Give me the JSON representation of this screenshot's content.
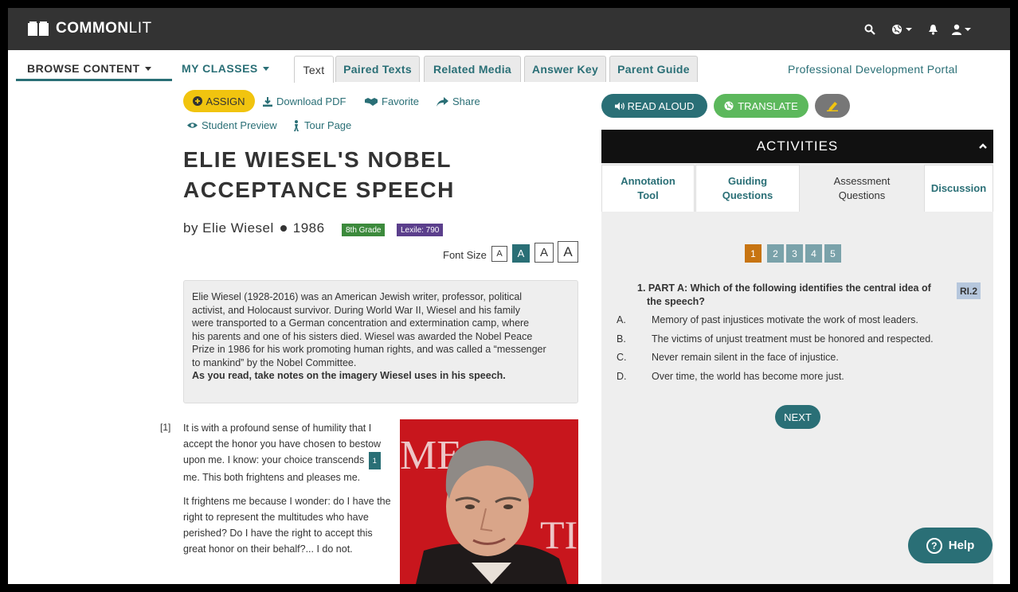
{
  "app": {
    "logo_bold": "COMMON",
    "logo_light": "LIT"
  },
  "nav": {
    "browse": "BROWSE CONTENT",
    "my_classes": "MY CLASSES",
    "tabs": [
      "Text",
      "Paired Texts",
      "Related Media",
      "Answer Key",
      "Parent Guide"
    ],
    "active_tab": "Text",
    "pd_portal": "Professional Development Portal"
  },
  "actions": {
    "assign": "ASSIGN",
    "download_pdf": "Download PDF",
    "favorite": "Favorite",
    "share": "Share",
    "student_preview": "Student Preview",
    "tour_page": "Tour Page"
  },
  "text": {
    "title_line1": "ELIE WIESEL'S NOBEL",
    "title_line2": "ACCEPTANCE SPEECH",
    "author": "by Elie Wiesel",
    "year": "1986",
    "grade": "8th Grade",
    "lexile": "Lexile: 790",
    "font_size_label": "Font Size",
    "font_size_buttons": [
      "A",
      "A",
      "A",
      "A"
    ],
    "font_size_active_index": 1,
    "intro_lines": [
      "Elie Wiesel (1928-2016) was an American Jewish writer, professor, political",
      "activist, and Holocaust survivor. During World War II, Wiesel and his family",
      "were transported to a German concentration and extermination camp, where",
      "his parents and one of his sisters died. Wiesel was awarded the Nobel Peace",
      "Prize in 1986 for his work promoting human rights, and was called a “messenger",
      "to mankind” by the Nobel Committee."
    ],
    "intro_bold": "As you read, take notes on the imagery Wiesel uses in his speech.",
    "para_num": "[1]",
    "p1_before": "It is with a profound sense of humility that I accept the honor you have chosen to bestow upon me. I know: your choice transcends",
    "p1_footnote": "1",
    "p1_after": "me. This both frightens and pleases me.",
    "p2": "It frightens me because I wonder: do I have the right to represent the multitudes who have perished? Do I have the right to accept this great honor on their behalf?... I do not."
  },
  "activities": {
    "read_aloud": "READ ALOUD",
    "translate": "TRANSLATE",
    "header": "ACTIVITIES",
    "tabs": [
      "Annotation Tool",
      "Guiding Questions",
      "Assessment Questions",
      "Discussion"
    ],
    "active_tab": "Assessment Questions",
    "question_numbers": [
      "1",
      "2",
      "3",
      "4",
      "5"
    ],
    "active_question": "1",
    "question": "1.  PART A: Which of the following identifies the central idea of the speech?",
    "standard": "RI.2",
    "options": [
      {
        "letter": "A.",
        "text": "Memory of past injustices motivate the work of most leaders."
      },
      {
        "letter": "B.",
        "text": "The victims of unjust treatment must be honored and respected."
      },
      {
        "letter": "C.",
        "text": "Never remain silent in the face of injustice."
      },
      {
        "letter": "D.",
        "text": "Over time, the world has become more just."
      }
    ],
    "next": "NEXT",
    "help": "Help"
  },
  "colors": {
    "teal": "#2a6f76",
    "yellow": "#f1c40f",
    "green": "#5cb85c",
    "orange": "#c77411",
    "topbar": "#333333"
  },
  "icons": [
    "book-icon",
    "search-icon",
    "globe-icon",
    "bell-icon",
    "user-icon",
    "download-icon",
    "handshake-icon",
    "share-icon",
    "eye-icon",
    "tour-icon",
    "speaker-icon",
    "pencil-icon",
    "chevron-up-icon",
    "question-circle-icon"
  ]
}
